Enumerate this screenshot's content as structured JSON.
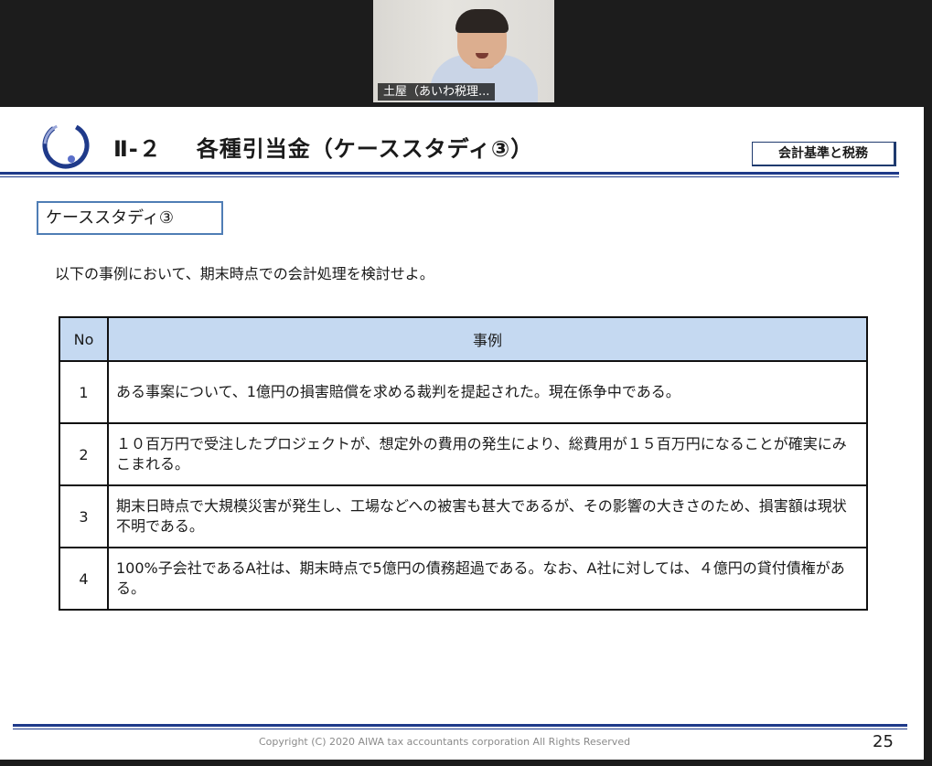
{
  "video": {
    "participant_name": "土屋（あいわ税理..."
  },
  "slide": {
    "section_no": "Ⅱ-２",
    "title": "各種引当金（ケーススタディ③）",
    "badge": "会計基準と税務",
    "case_label": "ケーススタディ③",
    "intro": "以下の事例において、期末時点での会計処理を検討せよ。",
    "table": {
      "headers": [
        "No",
        "事例"
      ],
      "rows": [
        {
          "no": "1",
          "text": "ある事案について、1億円の損害賠償を求める裁判を提起された。現在係争中である。"
        },
        {
          "no": "2",
          "text": "１０百万円で受注したプロジェクトが、想定外の費用の発生により、総費用が１５百万円になることが確実にみこまれる。"
        },
        {
          "no": "3",
          "text": "期末日時点で大規模災害が発生し、工場などへの被害も甚大であるが、その影響の大きさのため、損害額は現状不明である。"
        },
        {
          "no": "4",
          "text": "100%子会社であるA社は、期末時点で5億円の債務超過である。なお、A社に対しては、４億円の貸付債権がある。"
        }
      ]
    },
    "copyright": "Copyright (C) 2020 AIWA tax accountants corporation All Rights Reserved",
    "page_number": "25"
  },
  "icons": {
    "logo": "aiwa-circle-logo"
  },
  "colors": {
    "accent_navy": "#1f3a8a",
    "table_header_bg": "#c5d9f1",
    "case_box_border": "#4f7db5"
  }
}
